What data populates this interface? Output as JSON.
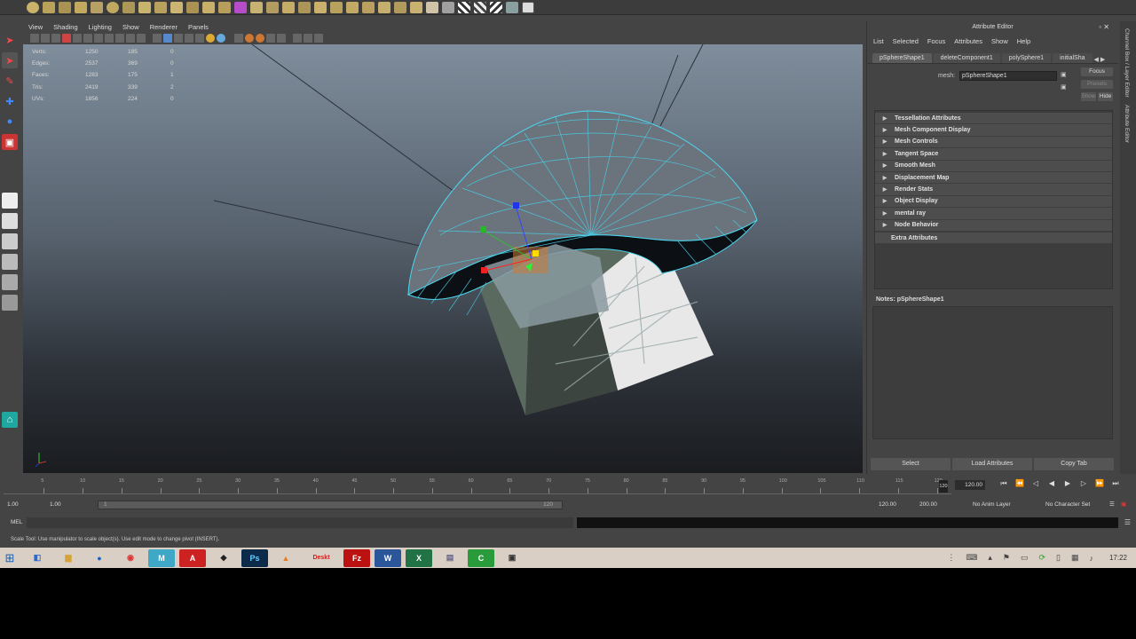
{
  "viewport": {
    "menu": [
      "View",
      "Shading",
      "Lighting",
      "Show",
      "Renderer",
      "Panels"
    ],
    "hud": [
      {
        "label": "Verts:",
        "a": "1250",
        "b": "185",
        "c": "0"
      },
      {
        "label": "Edges:",
        "a": "2537",
        "b": "369",
        "c": "0"
      },
      {
        "label": "Faces:",
        "a": "1283",
        "b": "175",
        "c": "1"
      },
      {
        "label": "Tris:",
        "a": "2419",
        "b": "339",
        "c": "2"
      },
      {
        "label": "UVs:",
        "a": "1856",
        "b": "224",
        "c": "0"
      }
    ]
  },
  "attribute_editor": {
    "title": "Attribute Editor",
    "menu": [
      "List",
      "Selected",
      "Focus",
      "Attributes",
      "Show",
      "Help"
    ],
    "tabs": [
      "pSphereShape1",
      "deleteComponent1",
      "polySphere1",
      "initialSha"
    ],
    "mesh_label": "mesh:",
    "mesh_value": "pSphereShape1",
    "focus_btn": "Focus",
    "presets_btn": "Presets",
    "show_btn": "Show",
    "hide_btn": "Hide",
    "sections": [
      "Tessellation Attributes",
      "Mesh Component Display",
      "Mesh Controls",
      "Tangent Space",
      "Smooth Mesh",
      "Displacement Map",
      "Render Stats",
      "Object Display",
      "mental ray",
      "Node Behavior"
    ],
    "extra": "Extra Attributes",
    "notes_label": "Notes: pSphereShape1",
    "buttons": [
      "Select",
      "Load Attributes",
      "Copy Tab"
    ]
  },
  "side_tabs": [
    "Channel Box / Layer Editor",
    "Attribute Editor"
  ],
  "timeslider": {
    "ticks": [
      "5",
      "10",
      "15",
      "20",
      "25",
      "30",
      "35",
      "40",
      "45",
      "50",
      "55",
      "60",
      "65",
      "70",
      "75",
      "80",
      "85",
      "90",
      "95",
      "100",
      "105",
      "110",
      "115",
      "120"
    ],
    "current_frame": "120.00",
    "playhead_label": "120"
  },
  "rangeslider": {
    "start": "1.00",
    "playback_start": "1.00",
    "bar_start": "1",
    "bar_end": "120",
    "playback_end": "120.00",
    "end": "200.00",
    "anim_layer": "No Anim Layer",
    "character_set": "No Character Set"
  },
  "cmdline": {
    "label": "MEL"
  },
  "helpline": "Scale Tool: Use manipulator to scale object(s). Use edit mode to change pivot (INSERT).",
  "taskbar": {
    "apps": [
      "desktop-app",
      "Deskt",
      "FileZilla",
      "Word",
      "Excel"
    ],
    "desk_label": "Deskt",
    "clock": "17:22"
  },
  "colors": {
    "accent": "#00e5ff",
    "taskbar": "#d9cfc5"
  }
}
